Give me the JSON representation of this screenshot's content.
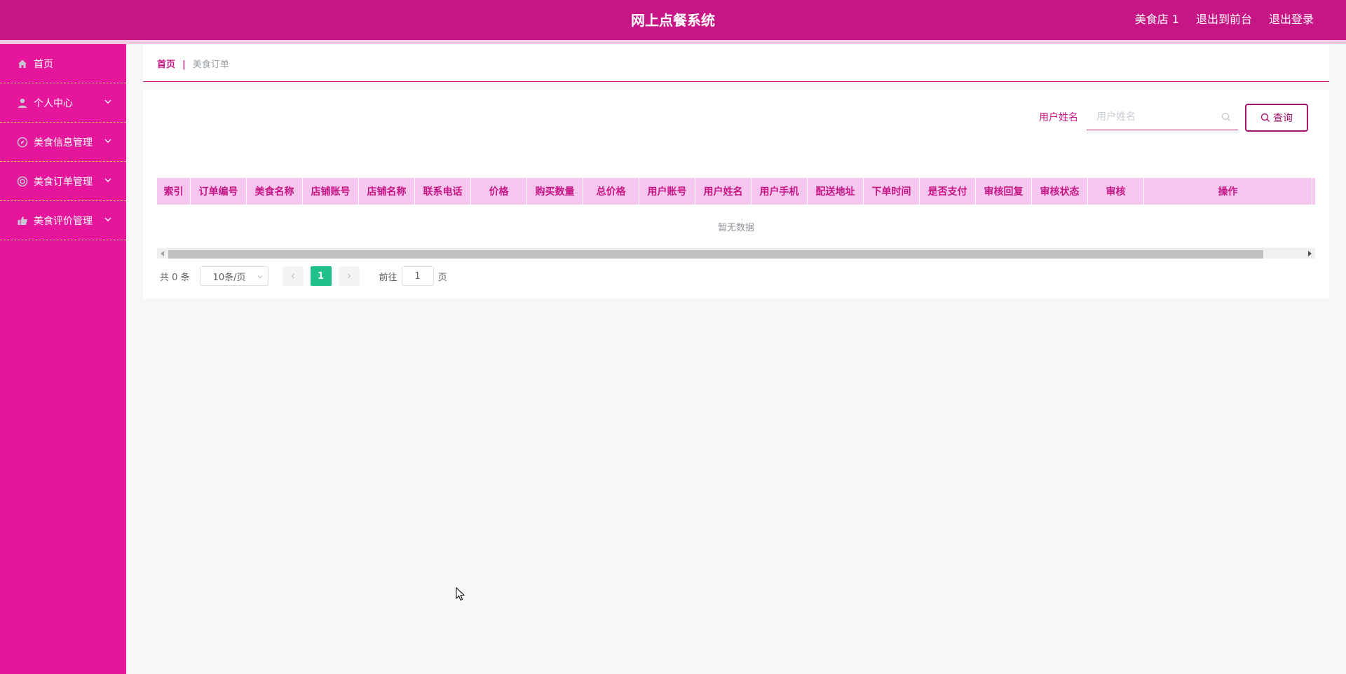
{
  "app": {
    "title": "网上点餐系统"
  },
  "header": {
    "user": "美食店 1",
    "to_front": "退出到前台",
    "logout": "退出登录"
  },
  "sidebar": {
    "items": [
      {
        "label": "首页",
        "icon": "home-icon"
      },
      {
        "label": "个人中心",
        "icon": "user-icon"
      },
      {
        "label": "美食信息管理",
        "icon": "compass-icon"
      },
      {
        "label": "美食订单管理",
        "icon": "lifebuoy-icon"
      },
      {
        "label": "美食评价管理",
        "icon": "thumb-icon"
      }
    ]
  },
  "breadcrumb": {
    "home": "首页",
    "separator": "|",
    "current": "美食订单"
  },
  "search": {
    "label": "用户姓名",
    "placeholder": "用户姓名",
    "button": "查询"
  },
  "table": {
    "columns": [
      "索引",
      "订单编号",
      "美食名称",
      "店铺账号",
      "店铺名称",
      "联系电话",
      "价格",
      "购买数量",
      "总价格",
      "用户账号",
      "用户姓名",
      "用户手机",
      "配送地址",
      "下单时间",
      "是否支付",
      "审核回复",
      "审核状态",
      "审核",
      "操作"
    ],
    "empty": "暂无数据"
  },
  "pagination": {
    "total": "共 0 条",
    "page_size": "10条/页",
    "current_page": "1",
    "goto_prefix": "前往",
    "goto_value": "1",
    "goto_suffix": "页"
  },
  "colors": {
    "header": "#c71585",
    "sidebar": "#e5169b",
    "table_header": "#f5c7ef",
    "active_page": "#1fc08b"
  }
}
